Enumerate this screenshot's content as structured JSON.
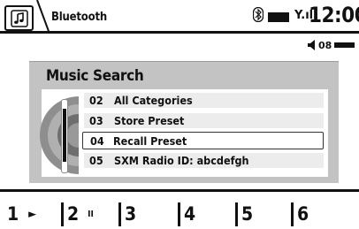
{
  "header": {
    "tab_label": "Bluetooth",
    "app_icon": "music-note-icon",
    "status": {
      "bluetooth_icon": "bluetooth-icon",
      "battery_icon": "battery-icon",
      "signal_text": "Y.ıl"
    },
    "clock": "12:00"
  },
  "volume": {
    "icon": "speaker-icon",
    "value": "08"
  },
  "panel": {
    "title": "Music Search",
    "items": [
      {
        "number": "02",
        "label": "All Categories",
        "selected": false
      },
      {
        "number": "03",
        "label": "Store Preset",
        "selected": false
      },
      {
        "number": "04",
        "label": "Recall Preset",
        "selected": true
      },
      {
        "number": "05",
        "label": "SXM Radio ID:  abcdefgh",
        "selected": false
      }
    ]
  },
  "presets": [
    {
      "label": "1",
      "state": "►",
      "state_icon": "play-icon"
    },
    {
      "label": "2",
      "state": "II",
      "state_icon": "pause-icon"
    },
    {
      "label": "3",
      "state": ""
    },
    {
      "label": "4",
      "state": ""
    },
    {
      "label": "5",
      "state": ""
    },
    {
      "label": "6",
      "state": ""
    }
  ]
}
